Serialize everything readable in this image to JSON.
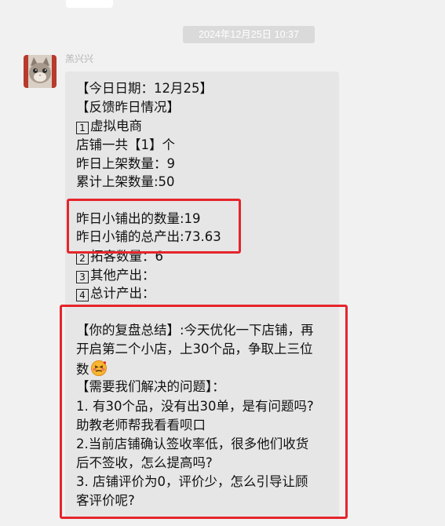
{
  "chat": {
    "timestamp": "2024年12月25日 10:37",
    "sender": "羔兴兴",
    "message": {
      "date_line": "【今日日期：12月25】",
      "feedback_title": "【反馈昨日情况】",
      "item1_num": "1",
      "item1_label": "虚拟电商",
      "store_count": "店铺一共【1】个",
      "listed_yesterday": "昨日上架数量：9",
      "listed_total": "累计上架数量:50",
      "sold_yesterday": "昨日小铺出的数量:19",
      "output_yesterday": "昨日小铺的总产出:73.63",
      "item2_num": "2",
      "item2_label": "拓客数量：6",
      "item3_num": "3",
      "item3_label": "其他产出：",
      "item4_num": "4",
      "item4_label": "总计产出：",
      "summary_line1": "【你的复盘总结】:今天优化一下店铺，再",
      "summary_line2": "开启第二个小店，上30个品，争取上三位",
      "summary_line3": "数",
      "problems_title": "【需要我们解决的问题】：",
      "problem1_line1": "1. 有30个品，没有出30单，是有问题吗?",
      "problem1_line2": "助教老师帮我看看呗口",
      "problem2_line1": "2.当前店铺确认签收率低，很多他们收货",
      "problem2_line2": "后不签收，怎么提高吗?",
      "problem3_line1": "3. 店铺评价为0，评价少，怎么引导让顾",
      "problem3_line2": "客评价呢?"
    }
  },
  "colors": {
    "highlight_border": "#e5252b",
    "bubble": "#e6e6e6",
    "background": "#f1f1f1"
  },
  "icons": {
    "avatar": "cat-avatar",
    "emoji": "strained-face-emoji"
  }
}
